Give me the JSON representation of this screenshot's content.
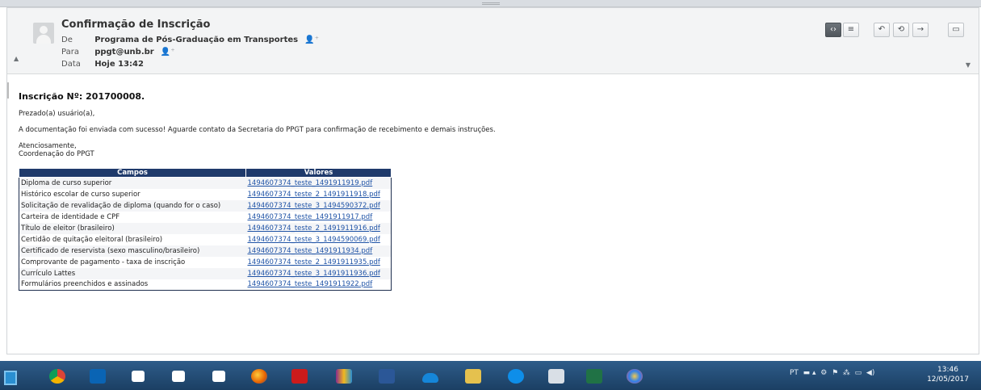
{
  "email": {
    "subject": "Confirmação de Inscrição",
    "from_label": "De",
    "from_value": "Programa de Pós-Graduação em Transportes",
    "to_label": "Para",
    "to_value": "ppgt@unb.br",
    "date_label": "Data",
    "date_value": "Hoje 13:42"
  },
  "toolbar": {
    "source_icon": "‹›",
    "plaintext_icon": "≡",
    "reply_icon": "↶",
    "reply_all_icon": "⟲",
    "forward_icon": "→",
    "popout_icon": "▭"
  },
  "message": {
    "inscricao": "Inscrição Nº: 201700008.",
    "greeting": "Prezado(a) usuário(a),",
    "text": "A documentação foi enviada com sucesso! Aguarde contato da Secretaria do PPGT para confirmação de recebimento e demais instruções.",
    "closing1": "Atenciosamente,",
    "closing2": "Coordenação do PPGT"
  },
  "table": {
    "headers": [
      "Campos",
      "Valores"
    ],
    "rows": [
      {
        "campo": "Diploma de curso superior",
        "valor": "1494607374_teste_1491911919.pdf"
      },
      {
        "campo": "Histórico escolar de curso superior",
        "valor": "1494607374_teste_2_1491911918.pdf"
      },
      {
        "campo": "Solicitação de revalidação de diploma (quando for o caso)",
        "valor": "1494607374_teste_3_1494590372.pdf"
      },
      {
        "campo": "Carteira de identidade e CPF",
        "valor": "1494607374_teste_1491911917.pdf"
      },
      {
        "campo": "Título de eleitor (brasileiro)",
        "valor": "1494607374_teste_2_1491911916.pdf"
      },
      {
        "campo": "Certidão de quitação eleitoral (brasileiro)",
        "valor": "1494607374_teste_3_1494590069.pdf"
      },
      {
        "campo": "Certificado de reservista (sexo masculino/brasileiro)",
        "valor": "1494607374_teste_1491911934.pdf"
      },
      {
        "campo": "Comprovante de pagamento - taxa de inscrição",
        "valor": "1494607374_teste_2_1491911935.pdf"
      },
      {
        "campo": "Currículo Lattes",
        "valor": "1494607374_teste_3_1491911936.pdf"
      },
      {
        "campo": "Formulários preenchidos e assinados",
        "valor": "1494607374_teste_1491911922.pdf"
      }
    ]
  },
  "taskbar": {
    "apps": [
      "chrome-icon",
      "outlook-icon",
      "folder-icon",
      "folder-icon",
      "folder-icon",
      "firefox-icon",
      "acrobat-icon",
      "winrar-icon",
      "word-icon",
      "onedrive-icon",
      "folder-icon",
      "teamviewer-icon",
      "paint-icon",
      "excel-icon",
      "paint-icon"
    ],
    "language": "PT",
    "time": "13:46",
    "date": "12/05/2017"
  }
}
